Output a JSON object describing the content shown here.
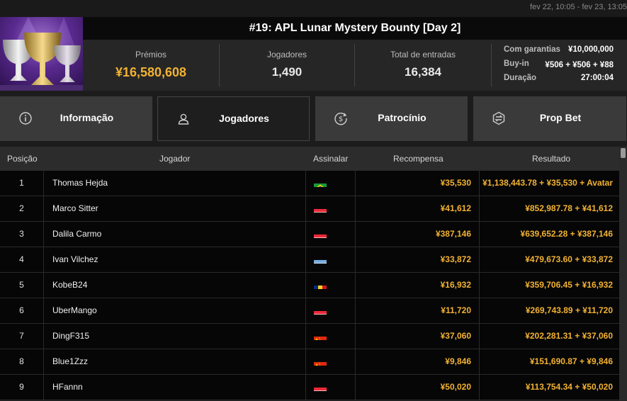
{
  "header": {
    "date_range": "fev 22, 10:05 - fev 23, 13:05",
    "title": "#19: APL Lunar Mystery Bounty [Day 2]"
  },
  "stats": {
    "prizes_label": "Prémios",
    "prizes_value": "¥16,580,608",
    "players_label": "Jogadores",
    "players_value": "1,490",
    "entries_label": "Total de entradas",
    "entries_value": "16,384"
  },
  "info": {
    "guarantee_label": "Com garantias",
    "guarantee_value": "¥10,000,000",
    "buyin_label": "Buy-in",
    "buyin_value": "¥506 + ¥506 + ¥88",
    "duration_label": "Duração",
    "duration_value": "27:00:04"
  },
  "tabs": [
    {
      "label": "Informação",
      "icon": "info-icon",
      "active": false
    },
    {
      "label": "Jogadores",
      "icon": "user-icon",
      "active": true
    },
    {
      "label": "Patrocínio",
      "icon": "dollar-coin-icon",
      "active": false
    },
    {
      "label": "Prop Bet",
      "icon": "prop-bet-icon",
      "active": false
    }
  ],
  "table": {
    "columns": [
      "Posição",
      "Jogador",
      "Assinalar",
      "Recompensa",
      "Resultado"
    ],
    "rows": [
      {
        "pos": "1",
        "player": "Thomas Hejda",
        "flag": "brazil",
        "reward": "¥35,530",
        "result": "¥1,138,443.78 + ¥35,530 + Avatar"
      },
      {
        "pos": "2",
        "player": "Marco Sitter",
        "flag": "austria",
        "reward": "¥41,612",
        "result": "¥852,987.78 + ¥41,612"
      },
      {
        "pos": "3",
        "player": "Dalila Carmo",
        "flag": "austria",
        "reward": "¥387,146",
        "result": "¥639,652.28 + ¥387,146"
      },
      {
        "pos": "4",
        "player": "Ivan Vilchez",
        "flag": "argentina",
        "reward": "¥33,872",
        "result": "¥479,673.60 + ¥33,872"
      },
      {
        "pos": "5",
        "player": "KobeB24",
        "flag": "romania",
        "reward": "¥16,932",
        "result": "¥359,706.45 + ¥16,932"
      },
      {
        "pos": "6",
        "player": "UberMango",
        "flag": "austria",
        "reward": "¥11,720",
        "result": "¥269,743.89 + ¥11,720"
      },
      {
        "pos": "7",
        "player": "DingF315",
        "flag": "china",
        "reward": "¥37,060",
        "result": "¥202,281.31 + ¥37,060"
      },
      {
        "pos": "8",
        "player": "Blue1Zzz",
        "flag": "china",
        "reward": "¥9,846",
        "result": "¥151,690.87 + ¥9,846"
      },
      {
        "pos": "9",
        "player": "HFannn",
        "flag": "austria",
        "reward": "¥50,020",
        "result": "¥113,754.34 + ¥50,020"
      }
    ]
  },
  "colors": {
    "gold": "#f2b233",
    "active_tab": "#1e1e1e",
    "tab": "#3a3a3a"
  }
}
